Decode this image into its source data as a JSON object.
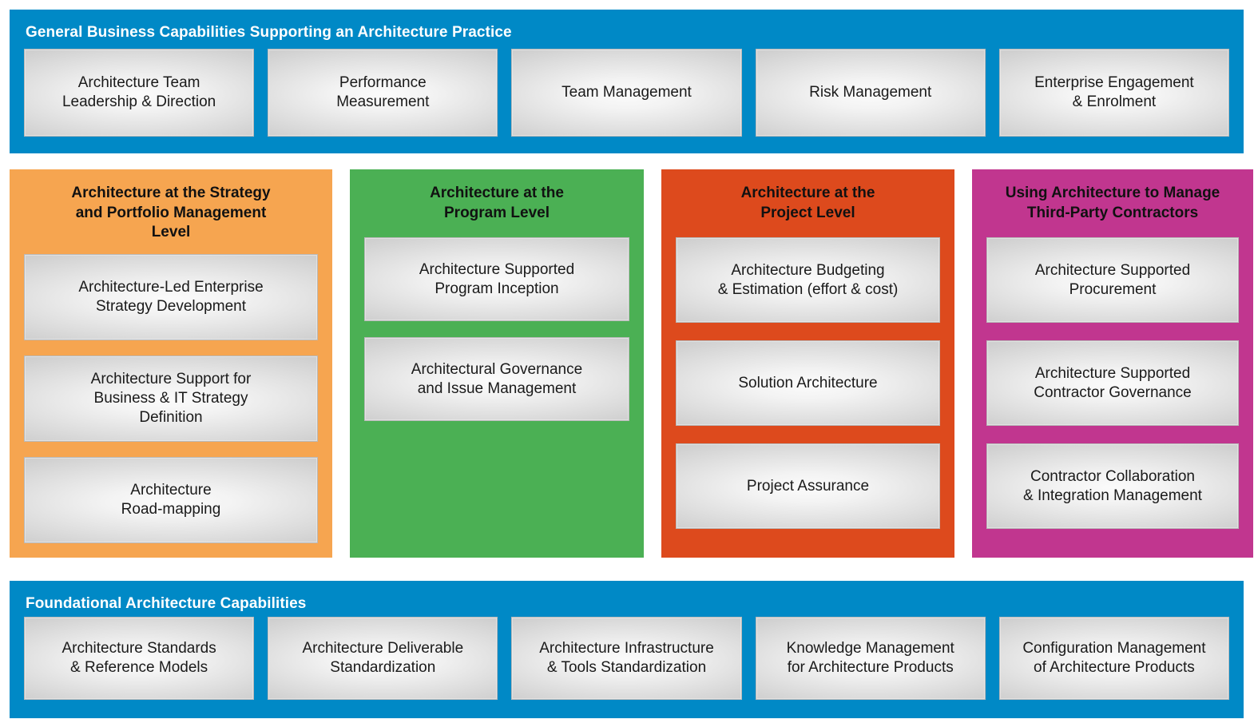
{
  "diagram": {
    "colors": {
      "blue": "#0089c6",
      "orange": "#f6a550",
      "green": "#4bb054",
      "red": "#dd4a1d",
      "magenta": "#c1368f",
      "box_light": "#fbfbfb",
      "box_dark": "#cfcfcf",
      "text_dark": "#1a1a1a",
      "text_light": "#ffffff"
    },
    "top_band": {
      "title": "General Business Capabilities Supporting an Architecture Practice",
      "boxes": [
        "Architecture Team\nLeadership & Direction",
        "Performance\nMeasurement",
        "Team Management",
        "Risk Management",
        "Enterprise Engagement\n& Enrolment"
      ]
    },
    "columns": [
      {
        "title": "Architecture at the Strategy\nand Portfolio Management\nLevel",
        "color": "#f6a550",
        "boxes": [
          "Architecture-Led Enterprise\nStrategy Development",
          "Architecture Support for\nBusiness & IT Strategy\nDefinition",
          "Architecture\nRoad-mapping"
        ]
      },
      {
        "title": "Architecture at the\nProgram Level",
        "color": "#4bb054",
        "boxes": [
          "Architecture Supported\nProgram Inception",
          "Architectural Governance\nand Issue Management"
        ]
      },
      {
        "title": "Architecture at the\nProject Level",
        "color": "#dd4a1d",
        "boxes": [
          "Architecture Budgeting\n& Estimation (effort & cost)",
          "Solution Architecture",
          "Project Assurance"
        ]
      },
      {
        "title": "Using Architecture to Manage\nThird-Party Contractors",
        "color": "#c1368f",
        "boxes": [
          "Architecture Supported\nProcurement",
          "Architecture Supported\nContractor Governance",
          "Contractor Collaboration\n& Integration Management"
        ]
      }
    ],
    "bottom_band": {
      "title": "Foundational Architecture Capabilities",
      "boxes": [
        "Architecture Standards\n& Reference Models",
        "Architecture Deliverable\nStandardization",
        "Architecture Infrastructure\n& Tools Standardization",
        "Knowledge Management\nfor Architecture Products",
        "Configuration Management\nof Architecture Products"
      ]
    }
  }
}
